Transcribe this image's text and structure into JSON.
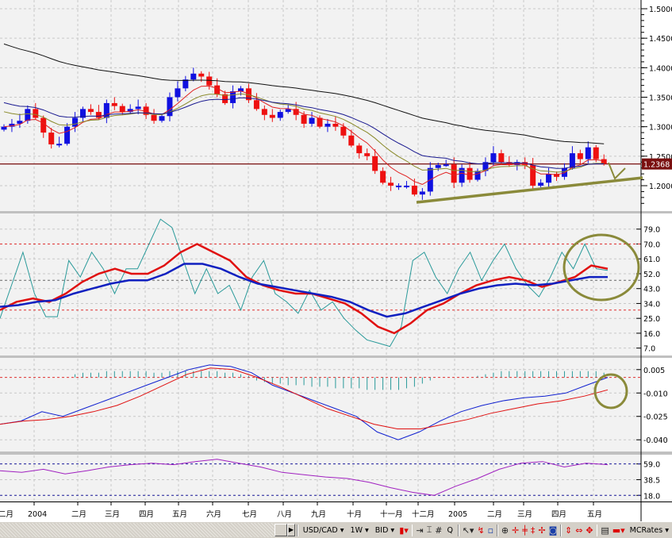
{
  "chart_data": {
    "type": "candlestick",
    "symbol": "USD/CAD",
    "timeframe": "1W",
    "price_axis": {
      "ticks": [
        "1.5000",
        "1.4500",
        "1.4000",
        "1.3500",
        "1.3000",
        "1.2500",
        "1.2000"
      ],
      "range": [
        1.17,
        1.51
      ]
    },
    "last_price": "1.2368",
    "closes": [
      1.3,
      1.305,
      1.31,
      1.33,
      1.315,
      1.29,
      1.27,
      1.271,
      1.3,
      1.315,
      1.33,
      1.325,
      1.315,
      1.34,
      1.335,
      1.325,
      1.33,
      1.334,
      1.32,
      1.31,
      1.318,
      1.35,
      1.365,
      1.38,
      1.39,
      1.385,
      1.37,
      1.355,
      1.34,
      1.36,
      1.365,
      1.345,
      1.33,
      1.32,
      1.315,
      1.325,
      1.33,
      1.32,
      1.305,
      1.315,
      1.3,
      1.305,
      1.3,
      1.285,
      1.268,
      1.255,
      1.25,
      1.225,
      1.205,
      1.2,
      1.2,
      1.2,
      1.185,
      1.19,
      1.23,
      1.235,
      1.236,
      1.205,
      1.23,
      1.21,
      1.225,
      1.24,
      1.255,
      1.24,
      1.235,
      1.24,
      1.235,
      1.2,
      1.205,
      1.22,
      1.215,
      1.23,
      1.255,
      1.245,
      1.265,
      1.245,
      1.237
    ],
    "first_open": 1.295,
    "moving_averages": [
      {
        "color": "#e02020",
        "period": 6,
        "seed": 1.3
      },
      {
        "color": "#8a8a2a",
        "period": 12,
        "seed": 1.33
      },
      {
        "color": "#1a1a90",
        "period": 20,
        "seed": 1.345
      },
      {
        "color": "#111111",
        "period": 60,
        "seed": 1.445
      }
    ],
    "oscillator": {
      "ticks": [
        "79.0",
        "70.0",
        "61.0",
        "52.0",
        "43.0",
        "34.0",
        "25.0",
        "16.0",
        "7.0"
      ],
      "range": [
        3,
        88
      ],
      "levels": [
        70,
        30
      ],
      "fast": [
        25,
        45,
        65,
        40,
        26,
        26,
        60,
        50,
        65,
        55,
        40,
        55,
        55,
        70,
        85,
        80,
        60,
        40,
        55,
        40,
        45,
        30,
        50,
        60,
        40,
        35,
        28,
        42,
        30,
        35,
        25,
        18,
        12,
        10,
        8,
        20,
        60,
        65,
        50,
        40,
        55,
        65,
        48,
        60,
        70,
        55,
        45,
        38,
        50,
        65,
        55,
        70,
        55,
        54
      ],
      "signal": [
        30,
        35,
        37,
        35,
        40,
        47,
        52,
        55,
        52,
        52,
        57,
        65,
        70,
        65,
        60,
        50,
        45,
        42,
        40,
        40,
        37,
        34,
        28,
        20,
        16,
        22,
        30,
        34,
        40,
        45,
        48,
        50,
        48,
        44,
        47,
        50,
        57,
        55
      ],
      "slow": [
        32,
        33,
        35,
        36,
        40,
        43,
        46,
        48,
        48,
        52,
        58,
        58,
        55,
        50,
        46,
        44,
        42,
        40,
        38,
        35,
        30,
        26,
        28,
        32,
        36,
        40,
        43,
        45,
        46,
        45,
        46,
        48,
        50,
        50
      ]
    },
    "macd": {
      "ticks": [
        "0.005",
        "-0.010",
        "-0.025",
        "-0.040"
      ],
      "range": [
        -0.047,
        0.012
      ],
      "macd": [
        -0.03,
        -0.028,
        -0.022,
        -0.025,
        -0.02,
        -0.015,
        -0.01,
        -0.005,
        0.0,
        0.005,
        0.008,
        0.007,
        0.003,
        -0.005,
        -0.01,
        -0.015,
        -0.02,
        -0.025,
        -0.035,
        -0.04,
        -0.035,
        -0.028,
        -0.022,
        -0.018,
        -0.015,
        -0.013,
        -0.012,
        -0.01,
        -0.005,
        0.0
      ],
      "signal": [
        -0.03,
        -0.028,
        -0.027,
        -0.025,
        -0.022,
        -0.018,
        -0.012,
        -0.005,
        0.002,
        0.006,
        0.005,
        0.0,
        -0.006,
        -0.013,
        -0.02,
        -0.025,
        -0.03,
        -0.033,
        -0.033,
        -0.03,
        -0.027,
        -0.023,
        -0.02,
        -0.017,
        -0.015,
        -0.012,
        -0.008
      ],
      "histogram": [
        0,
        0,
        0,
        0,
        0,
        0,
        0,
        0,
        0,
        0.002,
        0.003,
        0.003,
        0.003,
        0.004,
        0.004,
        0.004,
        0.004,
        0.004,
        0.004,
        0.003,
        0.003,
        0.004,
        0.004,
        0.004,
        0.004,
        0.004,
        0.004,
        0.004,
        0.003,
        0.003,
        0.002,
        0.001,
        -0.002,
        -0.003,
        -0.004,
        -0.004,
        -0.005,
        -0.005,
        -0.005,
        -0.006,
        -0.006,
        -0.006,
        -0.007,
        -0.007,
        -0.007,
        -0.007,
        -0.008,
        -0.008,
        -0.008,
        -0.008,
        -0.008,
        -0.007,
        -0.006,
        -0.004,
        -0.002,
        0,
        0,
        0,
        0,
        0,
        0.001,
        0.002,
        0.003,
        0.004,
        0.004,
        0.004,
        0.004,
        0.004,
        0.004,
        0.004,
        0.004,
        0.004,
        0.004,
        0.004,
        0.004,
        0.004,
        0.003
      ]
    },
    "lower": {
      "ticks": [
        "59.0",
        "38.5",
        "18.0"
      ],
      "range": [
        10,
        70
      ],
      "values": [
        50,
        48,
        52,
        46,
        50,
        55,
        58,
        60,
        58,
        62,
        65,
        60,
        55,
        48,
        45,
        42,
        40,
        35,
        28,
        22,
        18,
        30,
        40,
        52,
        60,
        62,
        55,
        60,
        58
      ]
    },
    "x_labels": [
      "二月",
      "2004",
      "二月",
      "三月",
      "四月",
      "五月",
      "六月",
      "七月",
      "八月",
      "九月",
      "十月",
      "十一月",
      "十二月",
      "2005",
      "二月",
      "三月",
      "四月",
      "五月"
    ]
  },
  "toolbar": {
    "symbol": "USD/CAD ▾",
    "timeframe": "1W ▾",
    "price_type": "BID ▾",
    "q_label": "Q",
    "provider": "MCRates ▾"
  },
  "colors": {
    "up": "#1010e0",
    "down": "#ee1010",
    "annotation": "#8a8a3a",
    "oscillator_fast": "#2a9a9a",
    "lower": "#a020c0"
  }
}
